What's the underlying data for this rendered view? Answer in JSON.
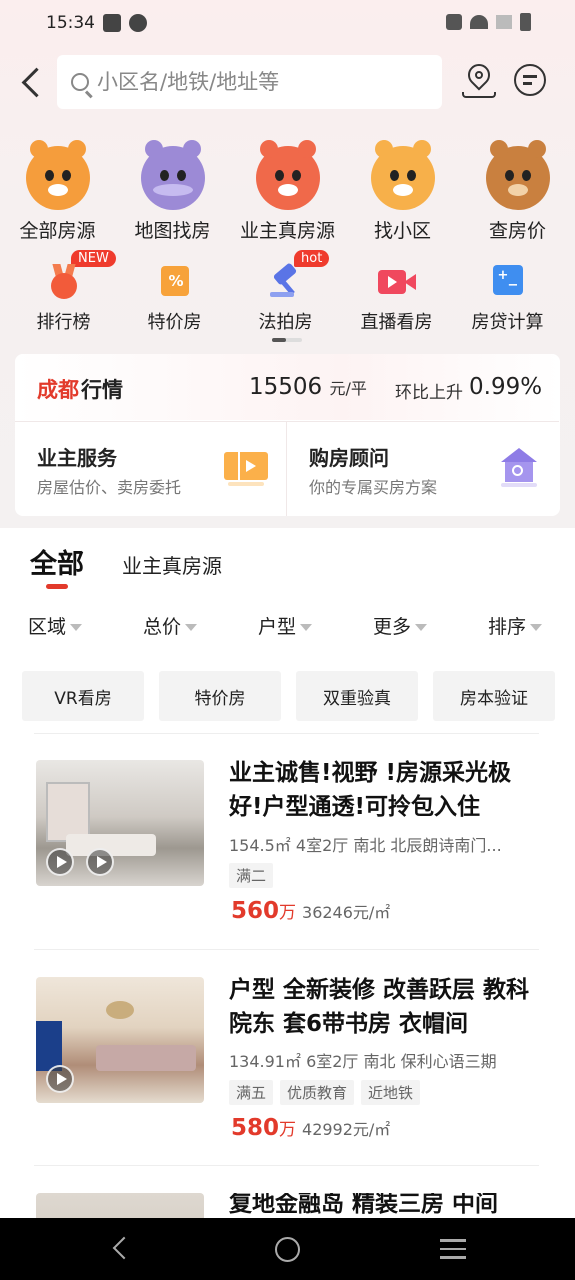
{
  "status_bar": {
    "time": "15:34"
  },
  "search": {
    "placeholder": "小区名/地铁/地址等"
  },
  "categories_row1": [
    {
      "label": "全部房源",
      "icon": "tiger-icon",
      "color": "#f59d3c"
    },
    {
      "label": "地图找房",
      "icon": "hippo-icon",
      "color": "#9c8ad6"
    },
    {
      "label": "业主真房源",
      "icon": "fox-icon",
      "color": "#f0694a"
    },
    {
      "label": "找小区",
      "icon": "cat-icon",
      "color": "#f7b04a"
    },
    {
      "label": "查房价",
      "icon": "bear-icon",
      "color": "#c9803f"
    }
  ],
  "categories_row2": [
    {
      "label": "排行榜",
      "icon": "medal-icon",
      "badge": "NEW"
    },
    {
      "label": "特价房",
      "icon": "discount-tag-icon",
      "badge": ""
    },
    {
      "label": "法拍房",
      "icon": "gavel-icon",
      "badge": "hot"
    },
    {
      "label": "直播看房",
      "icon": "video-camera-icon",
      "badge": ""
    },
    {
      "label": "房贷计算",
      "icon": "calculator-icon",
      "badge": ""
    }
  ],
  "market": {
    "city": "成都",
    "label": "行情",
    "price": "15506",
    "price_unit": "元/平",
    "mom_label": "环比上升",
    "mom_value": "0.99%"
  },
  "services": {
    "owner": {
      "title": "业主服务",
      "subtitle": "房屋估价、卖房委托",
      "icon": "ticket-icon"
    },
    "advisor": {
      "title": "购房顾问",
      "subtitle": "你的专属买房方案",
      "icon": "house-search-icon"
    }
  },
  "tabs": {
    "all": "全部",
    "owner": "业主真房源"
  },
  "filters": [
    "区域",
    "总价",
    "户型",
    "更多",
    "排序"
  ],
  "chips": [
    "VR看房",
    "特价房",
    "双重验真",
    "房本验证"
  ],
  "listings": [
    {
      "title": "业主诚售!视野 !房源采光极好!户型通透!可拎包入住",
      "info": "154.5㎡  4室2厅  南北  北辰朗诗南门...",
      "tags": [
        "满二"
      ],
      "price": "560",
      "price_unit": "万",
      "unit_price": "36246元/㎡"
    },
    {
      "title": "户型 全新装修 改善跃层 教科院东 套6带书房 衣帽间",
      "info": "134.91㎡  6室2厅  南北  保利心语三期",
      "tags": [
        "满五",
        "优质教育",
        "近地铁"
      ],
      "price": "580",
      "price_unit": "万",
      "unit_price": "42992元/㎡"
    },
    {
      "title": "复地金融岛 精装三房 中间"
    }
  ]
}
